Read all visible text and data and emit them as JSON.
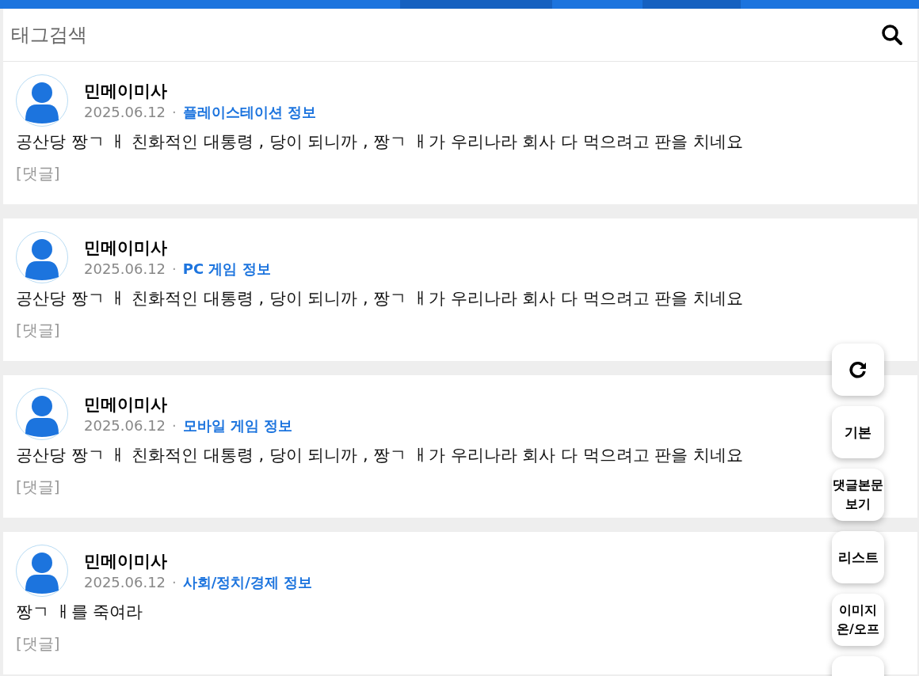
{
  "search": {
    "placeholder": "태그검색"
  },
  "posts": [
    {
      "author": "민메이미사",
      "date": "2025.06.12",
      "separator": "·",
      "category": "플레이스테이션 정보",
      "body": "공산당 짱ㄱ ㅐ 친화적인 대통령 , 당이 되니까 , 짱ㄱ ㅐ가 우리나라 회사 다 먹으려고 판을 치네요",
      "comments": "[댓글]"
    },
    {
      "author": "민메이미사",
      "date": "2025.06.12",
      "separator": "·",
      "category": "PC 게임 정보",
      "body": "공산당 짱ㄱ ㅐ 친화적인 대통령 , 당이 되니까 , 짱ㄱ ㅐ가 우리나라 회사 다 먹으려고 판을 치네요",
      "comments": "[댓글]"
    },
    {
      "author": "민메이미사",
      "date": "2025.06.12",
      "separator": "·",
      "category": "모바일 게임 정보",
      "body": "공산당 짱ㄱ ㅐ 친화적인 대통령 , 당이 되니까 , 짱ㄱ ㅐ가 우리나라 회사 다 먹으려고 판을 치네요",
      "comments": "[댓글]"
    },
    {
      "author": "민메이미사",
      "date": "2025.06.12",
      "separator": "·",
      "category": "사회/정치/경제 정보",
      "body": "짱ㄱ ㅐ를 죽여라",
      "comments": "[댓글]"
    }
  ],
  "floating_buttons": [
    {
      "kind": "icon"
    },
    {
      "kind": "text",
      "label": "기본"
    },
    {
      "kind": "text",
      "label": "댓글본문\n보기"
    },
    {
      "kind": "text",
      "label": "리스트"
    },
    {
      "kind": "text",
      "label": "이미지\n온/오프"
    },
    {
      "kind": "empty"
    }
  ]
}
